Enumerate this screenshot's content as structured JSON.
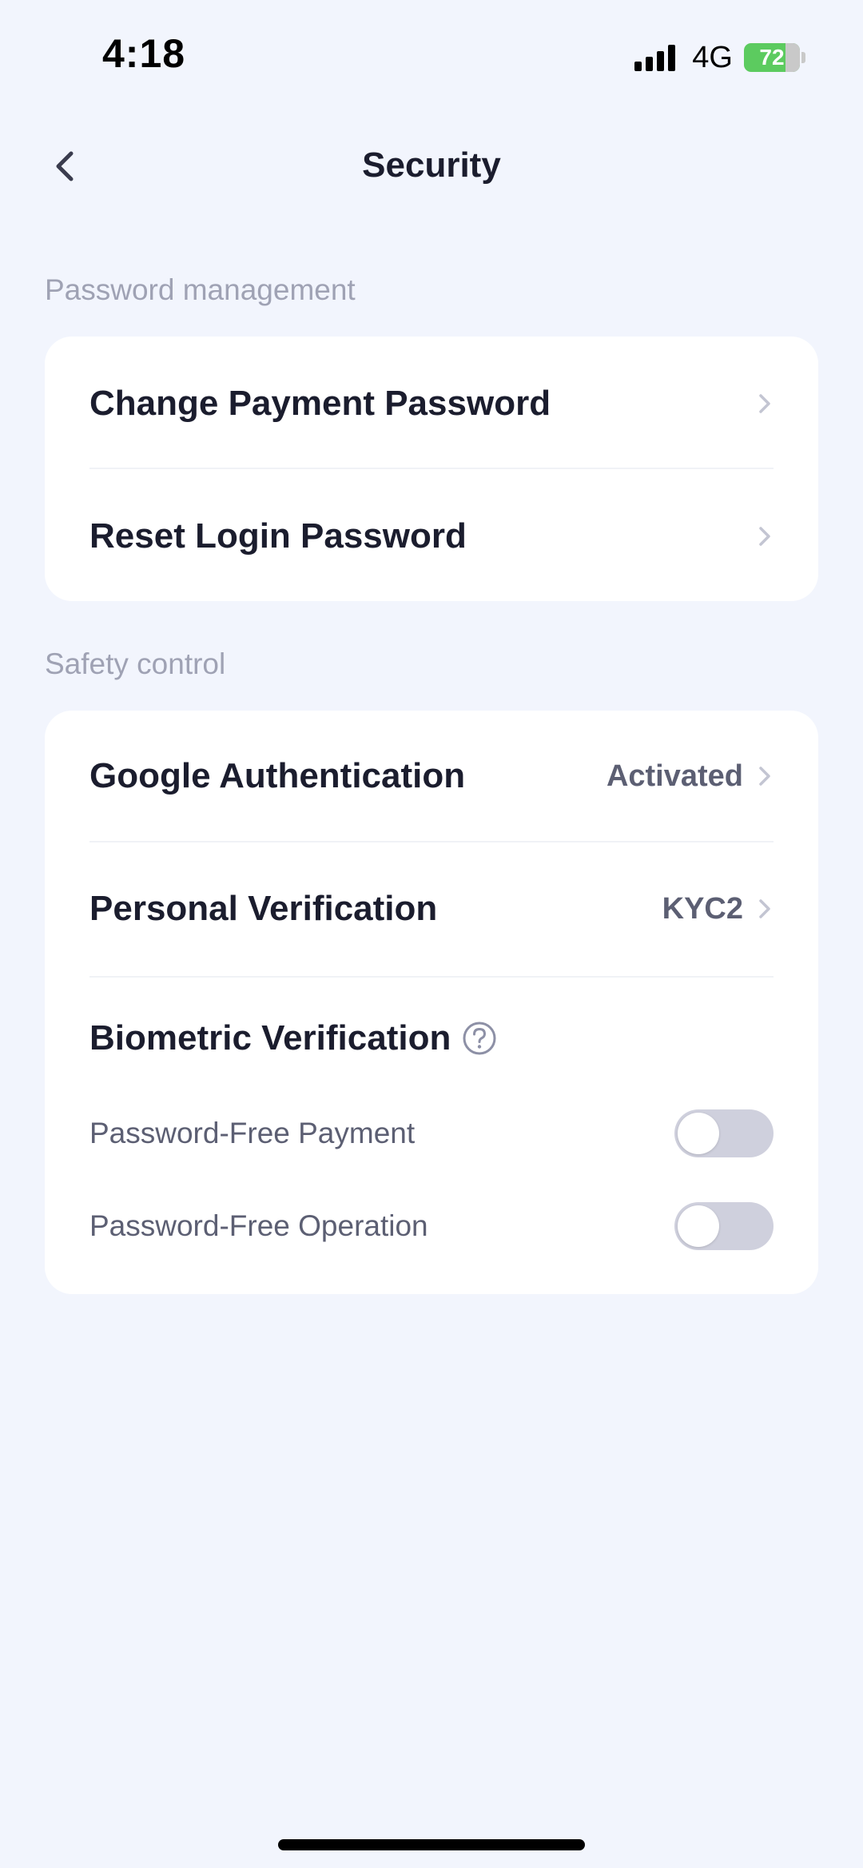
{
  "status_bar": {
    "time": "4:18",
    "network": "4G",
    "battery": "72"
  },
  "nav": {
    "title": "Security",
    "back_icon": "chevron-left-icon"
  },
  "password_section": {
    "label": "Password management",
    "items": [
      {
        "label": "Change Payment Password",
        "icon": "chevron-right-icon"
      },
      {
        "label": "Reset Login Password",
        "icon": "chevron-right-icon"
      }
    ]
  },
  "safety_section": {
    "label": "Safety control",
    "items": [
      {
        "label": "Google Authentication",
        "value": "Activated",
        "icon": "chevron-right-icon"
      },
      {
        "label": "Personal Verification",
        "value": "KYC2",
        "icon": "chevron-right-icon"
      }
    ],
    "biometric": {
      "title": "Biometric Verification",
      "help_icon": "question-circle-icon",
      "toggles": [
        {
          "label": "Password-Free Payment",
          "enabled": false
        },
        {
          "label": "Password-Free Operation",
          "enabled": false
        }
      ]
    }
  },
  "colors": {
    "background": "#f2f5fd",
    "card": "#ffffff",
    "text_primary": "#1b1d2e",
    "text_secondary": "#5c5f73",
    "section_label": "#9fa2b4",
    "toggle_off": "#cfd0dd",
    "battery": "#5ccb5f"
  }
}
